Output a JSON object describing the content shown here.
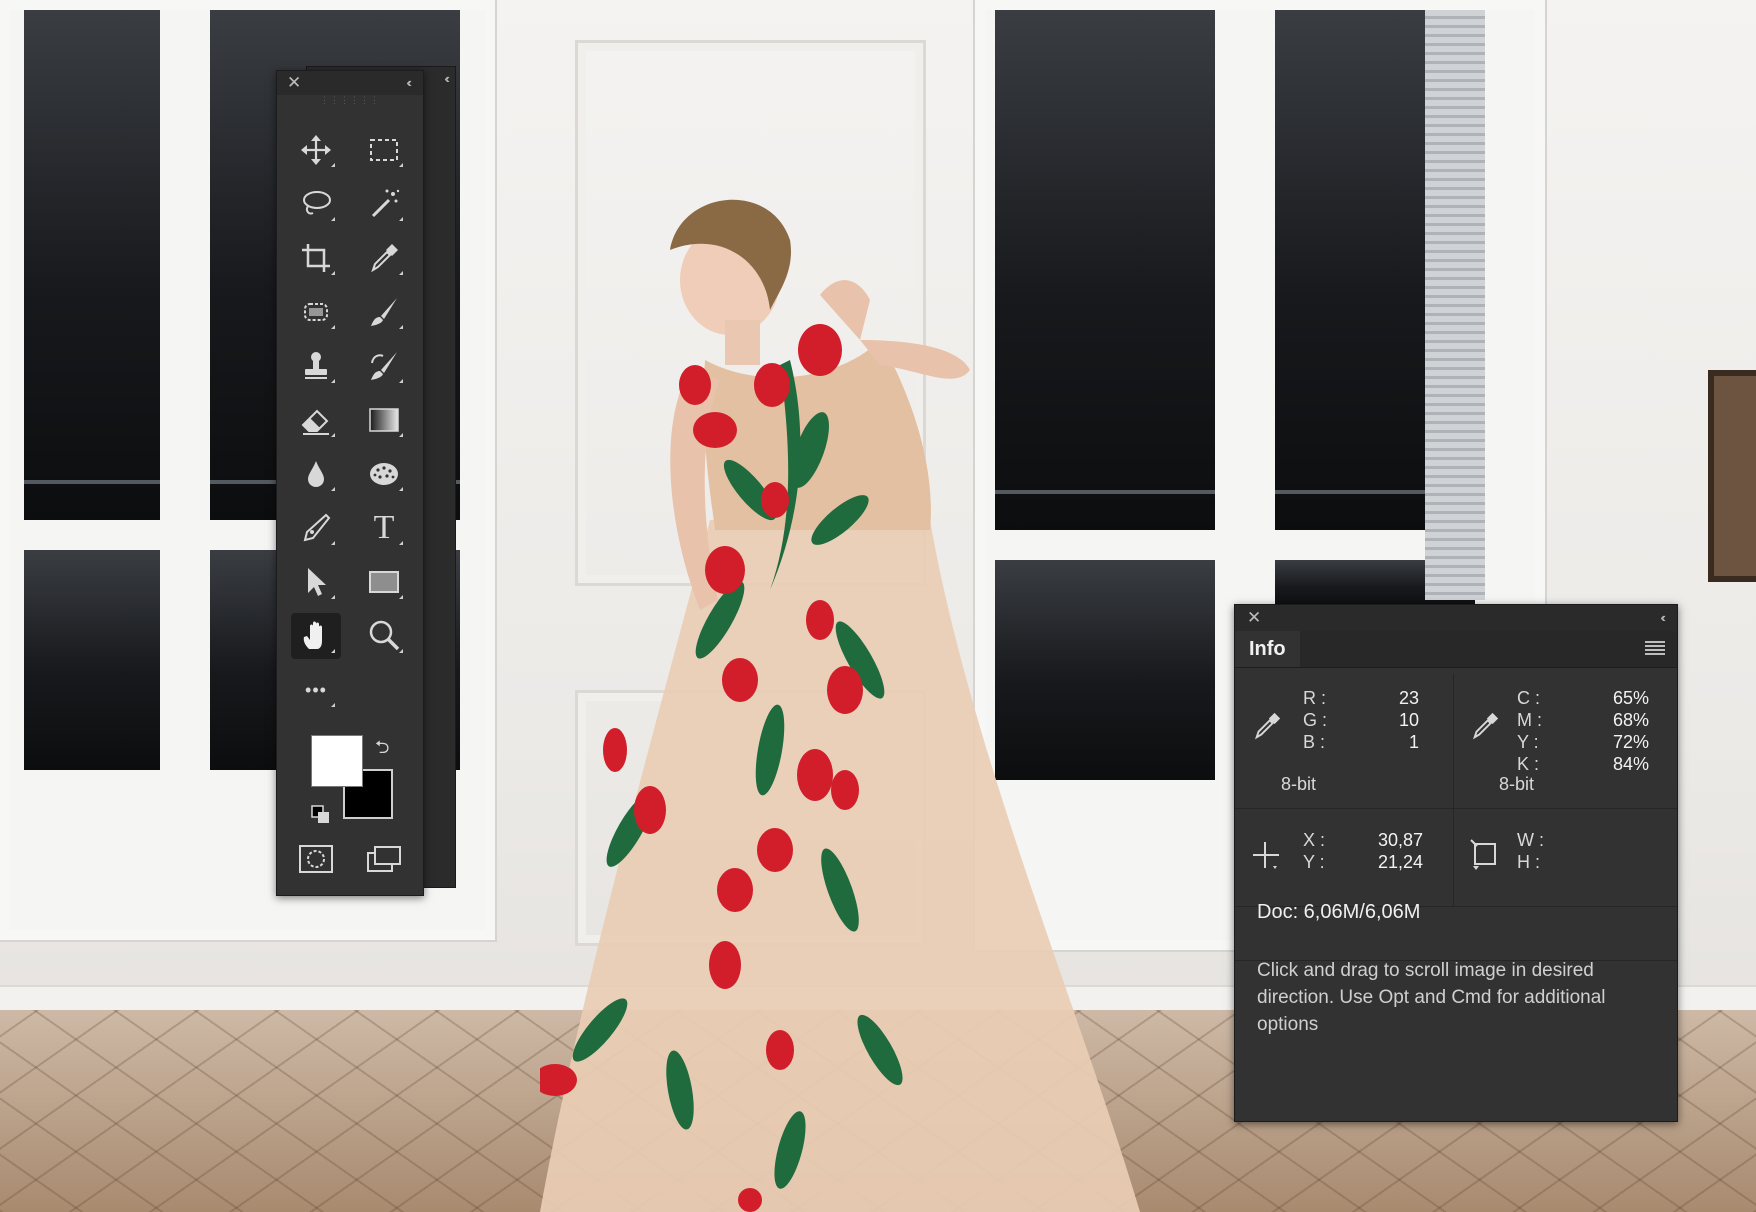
{
  "tools_panel": {
    "close_glyph": "✕",
    "collapse_glyph": "‹‹",
    "tools": [
      {
        "name": "move-tool",
        "icon": "move-icon"
      },
      {
        "name": "marquee-tool",
        "icon": "rect-marquee-icon"
      },
      {
        "name": "lasso-tool",
        "icon": "lasso-icon"
      },
      {
        "name": "magic-wand-tool",
        "icon": "magic-wand-icon"
      },
      {
        "name": "crop-tool",
        "icon": "crop-icon"
      },
      {
        "name": "eyedropper-tool",
        "icon": "eyedropper-icon"
      },
      {
        "name": "spot-healing-tool",
        "icon": "healing-icon"
      },
      {
        "name": "brush-tool",
        "icon": "brush-icon"
      },
      {
        "name": "clone-stamp-tool",
        "icon": "stamp-icon"
      },
      {
        "name": "history-brush-tool",
        "icon": "history-brush-icon"
      },
      {
        "name": "eraser-tool",
        "icon": "eraser-icon"
      },
      {
        "name": "gradient-tool",
        "icon": "gradient-icon"
      },
      {
        "name": "blur-tool",
        "icon": "drop-icon"
      },
      {
        "name": "sponge-tool",
        "icon": "sponge-icon"
      },
      {
        "name": "pen-tool",
        "icon": "pen-icon"
      },
      {
        "name": "type-tool",
        "icon": "type-icon"
      },
      {
        "name": "path-selection-tool",
        "icon": "arrow-icon"
      },
      {
        "name": "rectangle-tool",
        "icon": "rectangle-icon"
      },
      {
        "name": "hand-tool",
        "icon": "hand-icon",
        "active": true
      },
      {
        "name": "zoom-tool",
        "icon": "zoom-icon"
      },
      {
        "name": "edit-toolbar",
        "icon": "more-icon"
      }
    ],
    "type_glyph": "T",
    "more_glyph": "•••",
    "swap_glyph": "⮌",
    "foreground_color": "#ffffff",
    "background_color": "#000000"
  },
  "info_panel": {
    "close_glyph": "✕",
    "collapse_glyph": "‹‹",
    "tab_label": "Info",
    "rgb": {
      "r_label": "R :",
      "r_value": "23",
      "g_label": "G :",
      "g_value": "10",
      "b_label": "B :",
      "b_value": "1",
      "bit_depth": "8-bit"
    },
    "cmyk": {
      "c_label": "C :",
      "c_value": "65%",
      "m_label": "M :",
      "m_value": "68%",
      "y_label": "Y :",
      "y_value": "72%",
      "k_label": "K :",
      "k_value": "84%",
      "bit_depth": "8-bit"
    },
    "position": {
      "x_label": "X :",
      "x_value": "30,87",
      "y_label": "Y :",
      "y_value": "21,24"
    },
    "size": {
      "w_label": "W :",
      "w_value": "",
      "h_label": "H :",
      "h_value": ""
    },
    "doc": "Doc: 6,06M/6,06M",
    "hint": "Click and drag to scroll image in desired direction.  Use Opt and Cmd for additional options"
  },
  "colors": {
    "panel_bg": "#323232",
    "panel_header": "#2a2a2a",
    "dress_rose": "#d21e2a",
    "dress_leaf": "#1f6b3d",
    "dress_tulle": "#e6c6aa"
  }
}
